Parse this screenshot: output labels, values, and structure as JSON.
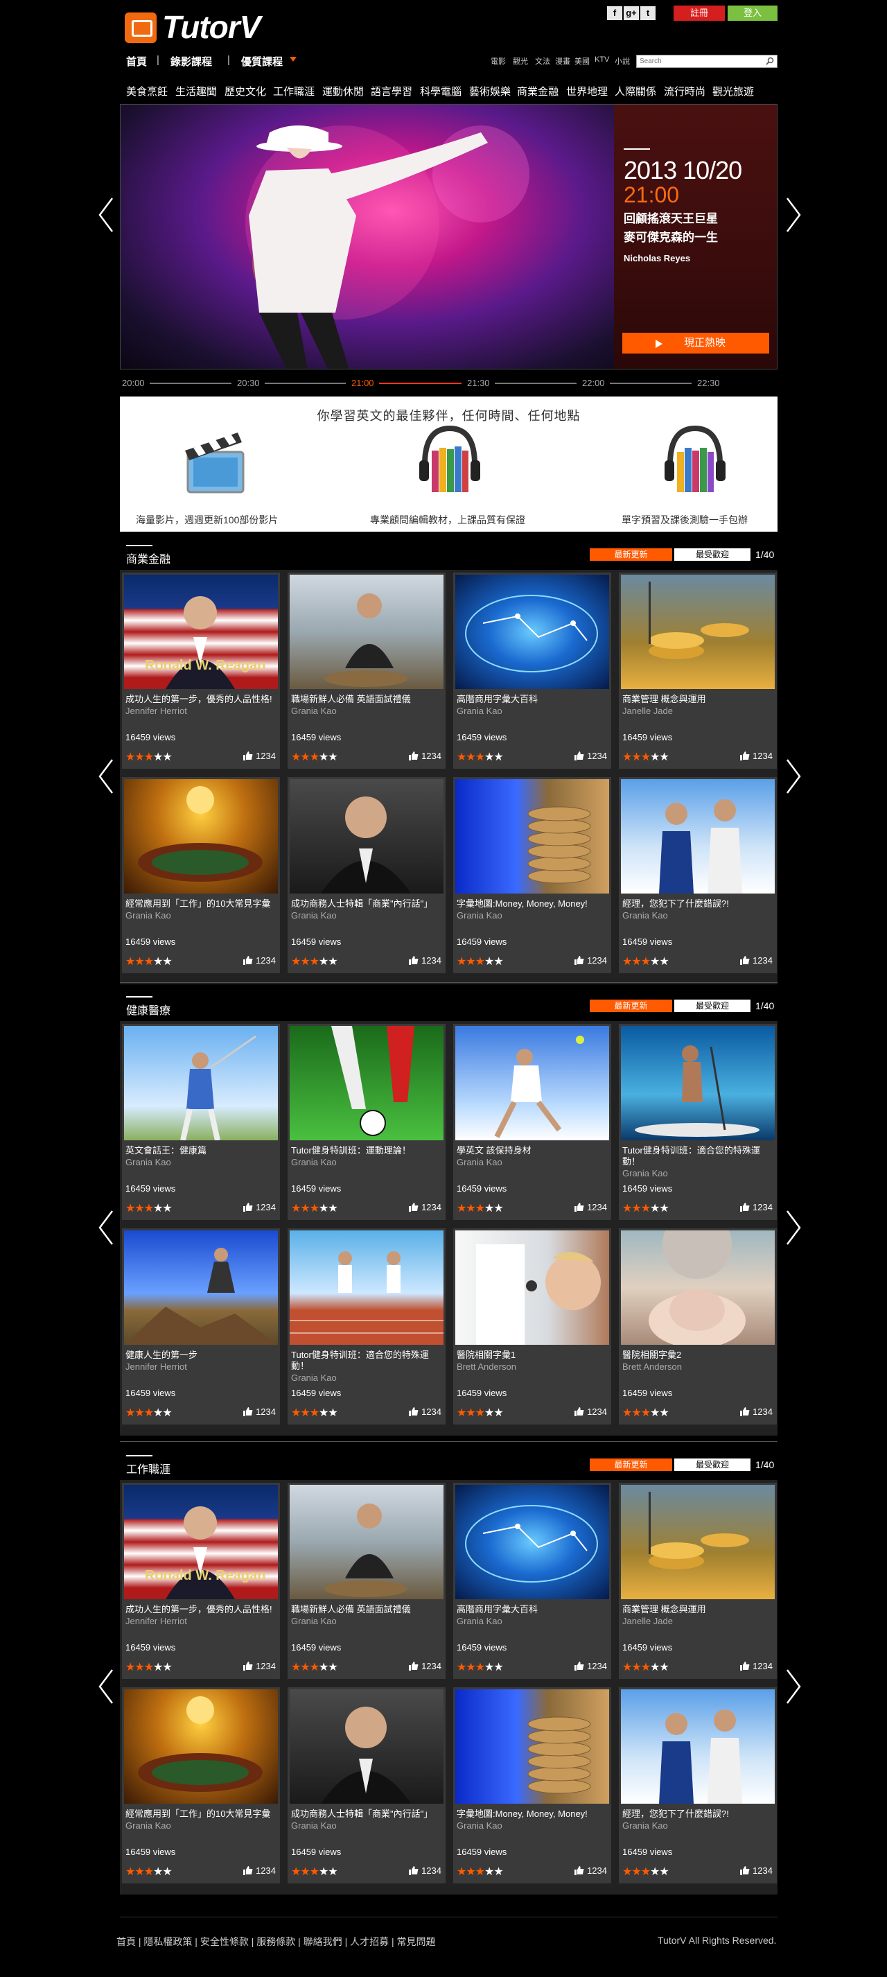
{
  "brand": {
    "name": "TutorV",
    "accent": "#ff5a00"
  },
  "social": [
    "f",
    "g+",
    "t"
  ],
  "auth": {
    "register": "註冊",
    "login": "登入"
  },
  "nav": [
    {
      "label": "首頁"
    },
    {
      "label": "錄影課程"
    },
    {
      "label": "優質課程"
    }
  ],
  "tags": [
    "電影",
    "觀光",
    "文法",
    "漫畫",
    "美國",
    "KTV",
    "小說"
  ],
  "search": {
    "placeholder": "Search"
  },
  "categories": [
    "美食烹飪",
    "生活趣聞",
    "歷史文化",
    "工作職涯",
    "運動休閒",
    "語言學習",
    "科學電腦",
    "藝術娛樂",
    "商業金融",
    "世界地理",
    "人際關係",
    "流行時尚",
    "觀光旅遊"
  ],
  "hero": {
    "date": "2013 10/20",
    "time": "21:00",
    "title1": "回顧搖滾天王巨星",
    "title2": "麥可傑克森的一生",
    "author": "Nicholas Reyes",
    "watch": "現正熱映"
  },
  "timeline": [
    "20:00",
    "20:30",
    "21:00",
    "21:30",
    "22:00",
    "22:30"
  ],
  "banner": {
    "headline": "你學習英文的最佳夥伴，任何時間、任何地點",
    "feat1": "海量影片，週週更新100部份影片",
    "feat2": "專業顧問編輯教材，上課品質有保證",
    "feat3": "單字預習及課後測驗一手包辦"
  },
  "tabs": {
    "new": "最新更新",
    "popular": "最受歡迎"
  },
  "sections": [
    {
      "title": "商業金融",
      "page": "1/40",
      "cards": [
        {
          "title": "成功人生的第一步，優秀的人品性格!",
          "author": "Jennifer Herriot",
          "views": "16459 views",
          "stars": 3,
          "likes": "1234",
          "overlay": "Ronald W. Reagan"
        },
        {
          "title": "職場新鮮人必備 英語面試禮儀",
          "author": "Grania Kao",
          "views": "16459 views",
          "stars": 3,
          "likes": "1234",
          "overlay": ""
        },
        {
          "title": "高階商用字彙大百科",
          "author": "Grania Kao",
          "views": "16459 views",
          "stars": 3,
          "likes": "1234",
          "overlay": ""
        },
        {
          "title": "商業管理 概念與運用",
          "author": "Janelle Jade",
          "views": "16459 views",
          "stars": 3,
          "likes": "1234",
          "overlay": ""
        },
        {
          "title": "經常應用到「工作」的10大常見字彙",
          "author": "Grania Kao",
          "views": "16459 views",
          "stars": 3,
          "likes": "1234",
          "overlay": ""
        },
        {
          "title": "成功商務人士特輯「商業\"內行話\"」",
          "author": "Grania Kao",
          "views": "16459 views",
          "stars": 3,
          "likes": "1234",
          "overlay": ""
        },
        {
          "title": "字彙地圖:Money, Money, Money!",
          "author": "Grania Kao",
          "views": "16459 views",
          "stars": 3,
          "likes": "1234",
          "overlay": ""
        },
        {
          "title": "經理，您犯下了什麼錯誤?!",
          "author": "Grania Kao",
          "views": "16459 views",
          "stars": 3,
          "likes": "1234",
          "overlay": ""
        }
      ]
    },
    {
      "title": "健康醫療",
      "page": "1/40",
      "cards": [
        {
          "title": "英文會話王：健康篇",
          "author": "Grania Kao",
          "views": "16459 views",
          "stars": 3,
          "likes": "1234",
          "overlay": ""
        },
        {
          "title": "Tutor健身特訓班：運動理論！",
          "author": "Grania Kao",
          "views": "16459 views",
          "stars": 3,
          "likes": "1234",
          "overlay": ""
        },
        {
          "title": "學英文 該保持身材",
          "author": "Grania Kao",
          "views": "16459 views",
          "stars": 3,
          "likes": "1234",
          "overlay": ""
        },
        {
          "title": "Tutor健身特训班：適合您的特殊運動！",
          "author": "Grania Kao",
          "views": "16459 views",
          "stars": 3,
          "likes": "1234",
          "overlay": ""
        },
        {
          "title": "健康人生的第一步",
          "author": "Jennifer Herriot",
          "views": "16459 views",
          "stars": 3,
          "likes": "1234",
          "overlay": ""
        },
        {
          "title": "Tutor健身特训班：適合您的特殊運動！",
          "author": "Grania Kao",
          "views": "16459 views",
          "stars": 3,
          "likes": "1234",
          "overlay": ""
        },
        {
          "title": "醫院相關字彙1",
          "author": "Brett Anderson",
          "views": "16459 views",
          "stars": 3,
          "likes": "1234",
          "overlay": ""
        },
        {
          "title": "醫院相關字彙2",
          "author": "Brett Anderson",
          "views": "16459 views",
          "stars": 3,
          "likes": "1234",
          "overlay": ""
        }
      ]
    },
    {
      "title": "工作職涯",
      "page": "1/40",
      "cards": [
        {
          "title": "成功人生的第一步，優秀的人品性格!",
          "author": "Jennifer Herriot",
          "views": "16459 views",
          "stars": 3,
          "likes": "1234",
          "overlay": "Ronald W. Reagan"
        },
        {
          "title": "職場新鮮人必備 英語面試禮儀",
          "author": "Grania Kao",
          "views": "16459 views",
          "stars": 3,
          "likes": "1234",
          "overlay": ""
        },
        {
          "title": "高階商用字彙大百科",
          "author": "Grania Kao",
          "views": "16459 views",
          "stars": 3,
          "likes": "1234",
          "overlay": ""
        },
        {
          "title": "商業管理 概念與運用",
          "author": "Janelle Jade",
          "views": "16459 views",
          "stars": 3,
          "likes": "1234",
          "overlay": ""
        },
        {
          "title": "經常應用到「工作」的10大常見字彙",
          "author": "Grania Kao",
          "views": "16459 views",
          "stars": 3,
          "likes": "1234",
          "overlay": ""
        },
        {
          "title": "成功商務人士特輯「商業\"內行話\"」",
          "author": "Grania Kao",
          "views": "16459 views",
          "stars": 3,
          "likes": "1234",
          "overlay": ""
        },
        {
          "title": "字彙地圖:Money, Money, Money!",
          "author": "Grania Kao",
          "views": "16459 views",
          "stars": 3,
          "likes": "1234",
          "overlay": ""
        },
        {
          "title": "經理，您犯下了什麼錯誤?!",
          "author": "Grania Kao",
          "views": "16459 views",
          "stars": 3,
          "likes": "1234",
          "overlay": ""
        }
      ]
    }
  ],
  "footer": {
    "links": [
      "首頁",
      "隱私權政策",
      "安全性條款",
      "服務條款",
      "聯絡我們",
      "人才招募",
      "常見問題"
    ],
    "copyright": "TutorV All Rights Reserved."
  }
}
